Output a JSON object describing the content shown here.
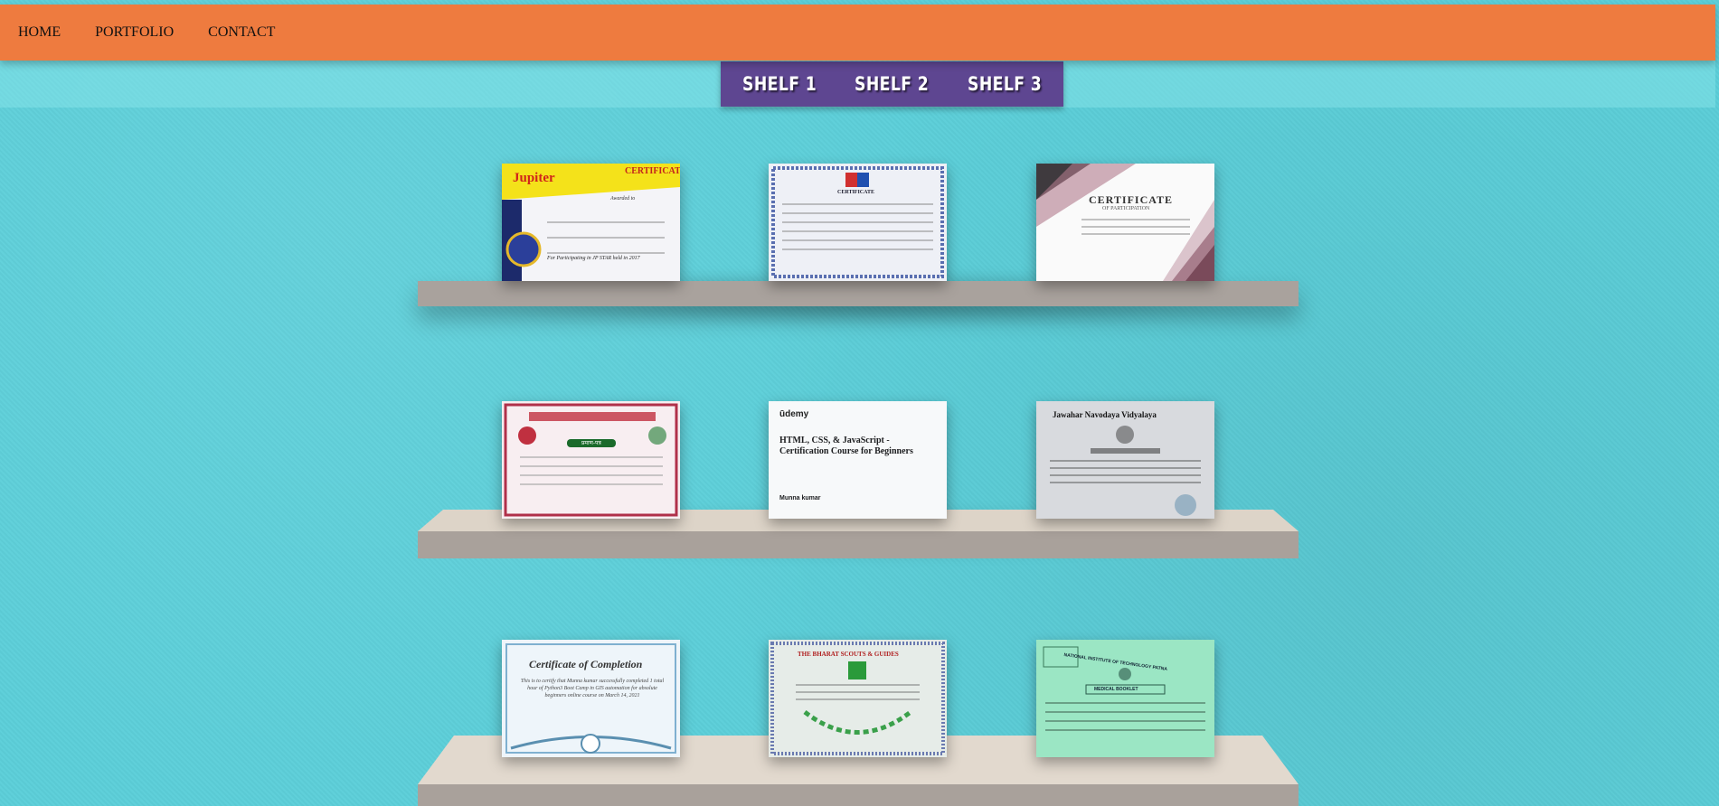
{
  "nav": {
    "home": "HOME",
    "portfolio": "PORTFOLIO",
    "contact": "CONTACT"
  },
  "shelves_menu": {
    "shelf1": "SHELF 1",
    "shelf2": "SHELF 2",
    "shelf3": "SHELF 3"
  },
  "certificates": {
    "jupiter": {
      "brand": "Jupiter",
      "title": "CERTIFICATE",
      "line": "Awarded to",
      "footer": "For Participating in JP STAR held in 2017"
    },
    "science": {
      "title": "CERTIFICATE"
    },
    "participation": {
      "title": "CERTIFICATE",
      "subtitle": "OF PARTICIPATION"
    },
    "hindi": {
      "badge": "प्रमाण-पत्र"
    },
    "udemy": {
      "brand": "ūdemy",
      "course": "HTML, CSS, & JavaScript - Certification Course for Beginners",
      "name": "Munna kumar"
    },
    "jnv": {
      "title": "Jawahar Navodaya Vidyalaya"
    },
    "completion": {
      "title": "Certificate of Completion",
      "body": "This is to certify that Munna kumar successfully completed 1 total hour of Python3 Boot Camp in GIS automation for absolute beginners online course on March 14, 2021"
    },
    "scouts": {
      "title": "THE BHARAT SCOUTS & GUIDES"
    },
    "nit": {
      "title": "NATIONAL INSTITUTE OF TECHNOLOGY PATNA",
      "subtitle": "MEDICAL BOOKLET"
    }
  },
  "colors": {
    "topbar": "#ee7b3f",
    "shelf_menu": "#5e4691",
    "wall": "#5ccfd9",
    "shelf_top": "#ddd4c8",
    "shelf_front": "#a9a19b"
  }
}
